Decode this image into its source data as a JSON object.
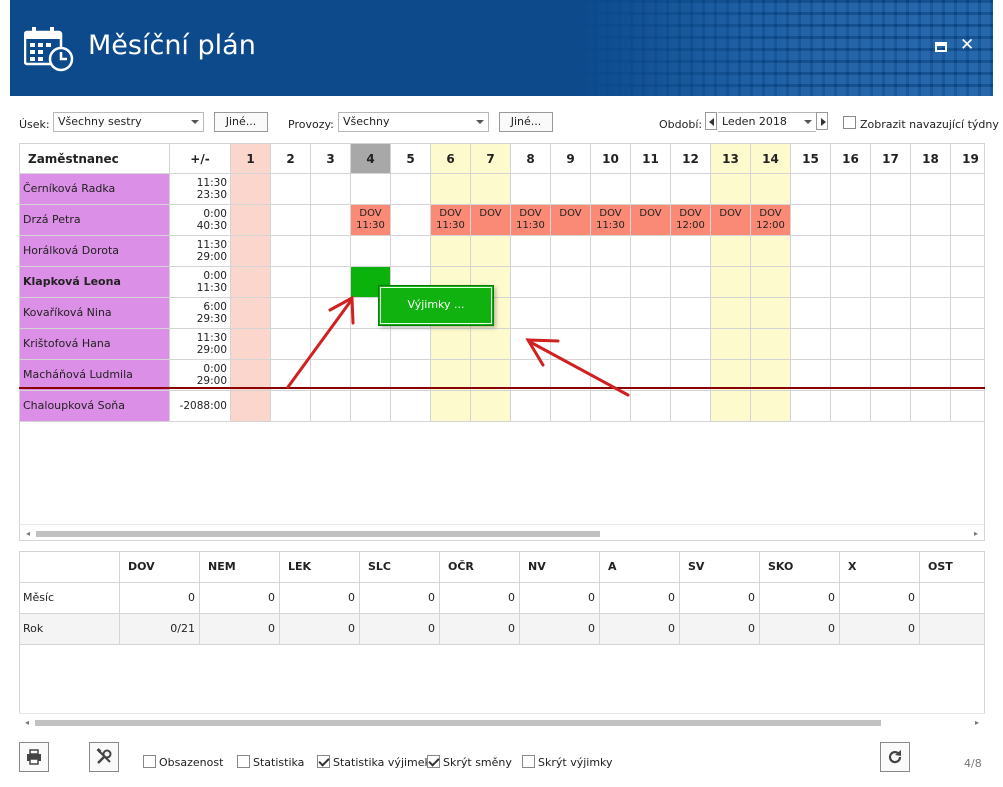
{
  "window": {
    "title": "Měsíční plán",
    "maximize_icon": "maximize-icon",
    "close_icon": "close-icon",
    "close_glyph": "✕"
  },
  "filters": {
    "usek_label": "Úsek:",
    "usek_value": "Všechny sestry",
    "usek_other": "Jiné...",
    "provozy_label": "Provozy:",
    "provozy_value": "Všechny",
    "provozy_other": "Jiné...",
    "obdobi_label": "Období:",
    "obdobi_value": "Leden 2018",
    "show_following_weeks": "Zobrazit navazující týdny"
  },
  "grid": {
    "employee_header": "Zaměstnanec",
    "balance_header": "+/-",
    "days": [
      {
        "n": "1",
        "type": "holiday"
      },
      {
        "n": "2",
        "type": "normal"
      },
      {
        "n": "3",
        "type": "normal"
      },
      {
        "n": "4",
        "type": "today"
      },
      {
        "n": "5",
        "type": "normal"
      },
      {
        "n": "6",
        "type": "weekend"
      },
      {
        "n": "7",
        "type": "weekend"
      },
      {
        "n": "8",
        "type": "normal"
      },
      {
        "n": "9",
        "type": "normal"
      },
      {
        "n": "10",
        "type": "normal"
      },
      {
        "n": "11",
        "type": "normal"
      },
      {
        "n": "12",
        "type": "normal"
      },
      {
        "n": "13",
        "type": "weekend"
      },
      {
        "n": "14",
        "type": "weekend"
      },
      {
        "n": "15",
        "type": "normal"
      },
      {
        "n": "16",
        "type": "normal"
      },
      {
        "n": "17",
        "type": "normal"
      },
      {
        "n": "18",
        "type": "normal"
      },
      {
        "n": "19",
        "type": "normal"
      }
    ],
    "rows": [
      {
        "name": "Černíková Radka",
        "b1": "11:30",
        "b2": "23:30",
        "bold": false,
        "shifts": {}
      },
      {
        "name": "Drzá Petra",
        "b1": "0:00",
        "b2": "40:30",
        "bold": false,
        "shifts": {
          "4": [
            "DOV",
            "11:30"
          ],
          "6": [
            "DOV",
            "11:30"
          ],
          "7": [
            "DOV",
            ""
          ],
          "8": [
            "DOV",
            "11:30"
          ],
          "9": [
            "DOV",
            ""
          ],
          "10": [
            "DOV",
            "11:30"
          ],
          "11": [
            "DOV",
            ""
          ],
          "12": [
            "DOV",
            "12:00"
          ],
          "13": [
            "DOV",
            ""
          ],
          "14": [
            "DOV",
            "12:00"
          ]
        }
      },
      {
        "name": "Horálková Dorota",
        "b1": "11:30",
        "b2": "29:00",
        "bold": false,
        "shifts": {}
      },
      {
        "name": "Klapková Leona",
        "b1": "0:00",
        "b2": "11:30",
        "bold": true,
        "shifts": {},
        "selected_day": "4"
      },
      {
        "name": "Kovaříková Nina",
        "b1": "6:00",
        "b2": "29:30",
        "bold": false,
        "shifts": {}
      },
      {
        "name": "Krištofová Hana",
        "b1": "11:30",
        "b2": "29:00",
        "bold": false,
        "shifts": {}
      },
      {
        "name": "Macháňová Ludmila",
        "b1": "0:00",
        "b2": "29:00",
        "bold": false,
        "shifts": {}
      },
      {
        "name": "Chaloupková Soňa",
        "b1": "-2088:00",
        "b2": "",
        "bold": false,
        "shifts": {}
      }
    ],
    "context_popup": "Výjimky ...",
    "colors": {
      "employee_bg": "#dc8fe6",
      "shift_bg": "#fa8a76",
      "weekend_bg": "#fdfacd",
      "holiday_bg": "#fad6cc",
      "selected_bg": "#0cb20c",
      "arrow": "#d02020"
    }
  },
  "stats": {
    "columns": [
      "DOV",
      "NEM",
      "LEK",
      "SLC",
      "OČR",
      "NV",
      "A",
      "SV",
      "SKO",
      "X",
      "OST"
    ],
    "rows": [
      {
        "label": "Měsíc",
        "values": [
          "0",
          "0",
          "0",
          "0",
          "0",
          "0",
          "0",
          "0",
          "0",
          "0",
          ""
        ]
      },
      {
        "label": "Rok",
        "values": [
          "0/21",
          "0",
          "0",
          "0",
          "0",
          "0",
          "0",
          "0",
          "0",
          "0",
          ""
        ]
      }
    ]
  },
  "toolbar": {
    "print_icon": "print-icon",
    "tools_icon": "tools-icon",
    "refresh_icon": "refresh-icon",
    "checkboxes": [
      {
        "label": "Obsazenost",
        "checked": false
      },
      {
        "label": "Statistika",
        "checked": false
      },
      {
        "label": "Statistika výjimek",
        "checked": true
      },
      {
        "label": "Skrýt směny",
        "checked": true
      },
      {
        "label": "Skrýt výjimky",
        "checked": false
      }
    ],
    "page_indicator": "4/8"
  }
}
